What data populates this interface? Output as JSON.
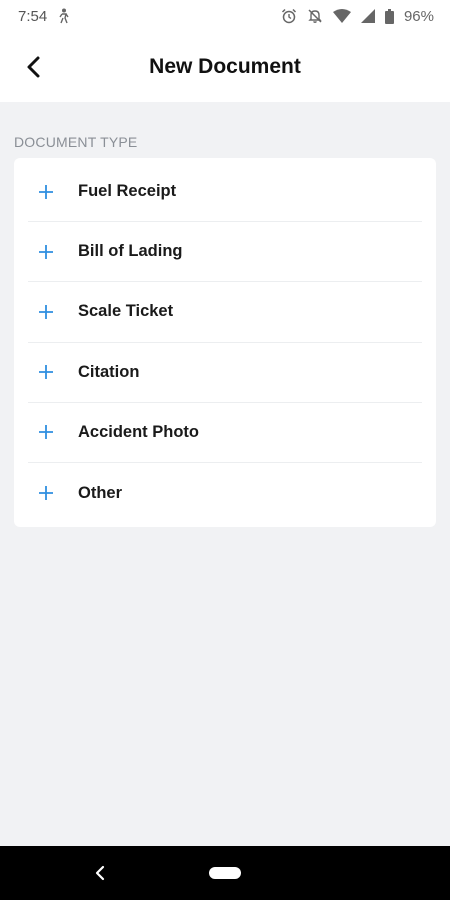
{
  "status_bar": {
    "time": "7:54",
    "battery_percent": "96%",
    "icons": [
      "person-walk-icon",
      "alarm-icon",
      "notifications-off-icon",
      "wifi-icon",
      "signal-icon",
      "battery-icon"
    ]
  },
  "header": {
    "title": "New Document",
    "back_icon": "chevron-left-icon"
  },
  "section": {
    "label": "DOCUMENT TYPE"
  },
  "document_types": [
    {
      "label": "Fuel Receipt",
      "icon": "plus-icon"
    },
    {
      "label": "Bill of Lading",
      "icon": "plus-icon"
    },
    {
      "label": "Scale Ticket",
      "icon": "plus-icon"
    },
    {
      "label": "Citation",
      "icon": "plus-icon"
    },
    {
      "label": "Accident Photo",
      "icon": "plus-icon"
    },
    {
      "label": "Other",
      "icon": "plus-icon"
    }
  ],
  "colors": {
    "accent": "#2f8fe0",
    "background": "#f1f2f4",
    "card": "#ffffff",
    "nav_bar": "#000000"
  }
}
